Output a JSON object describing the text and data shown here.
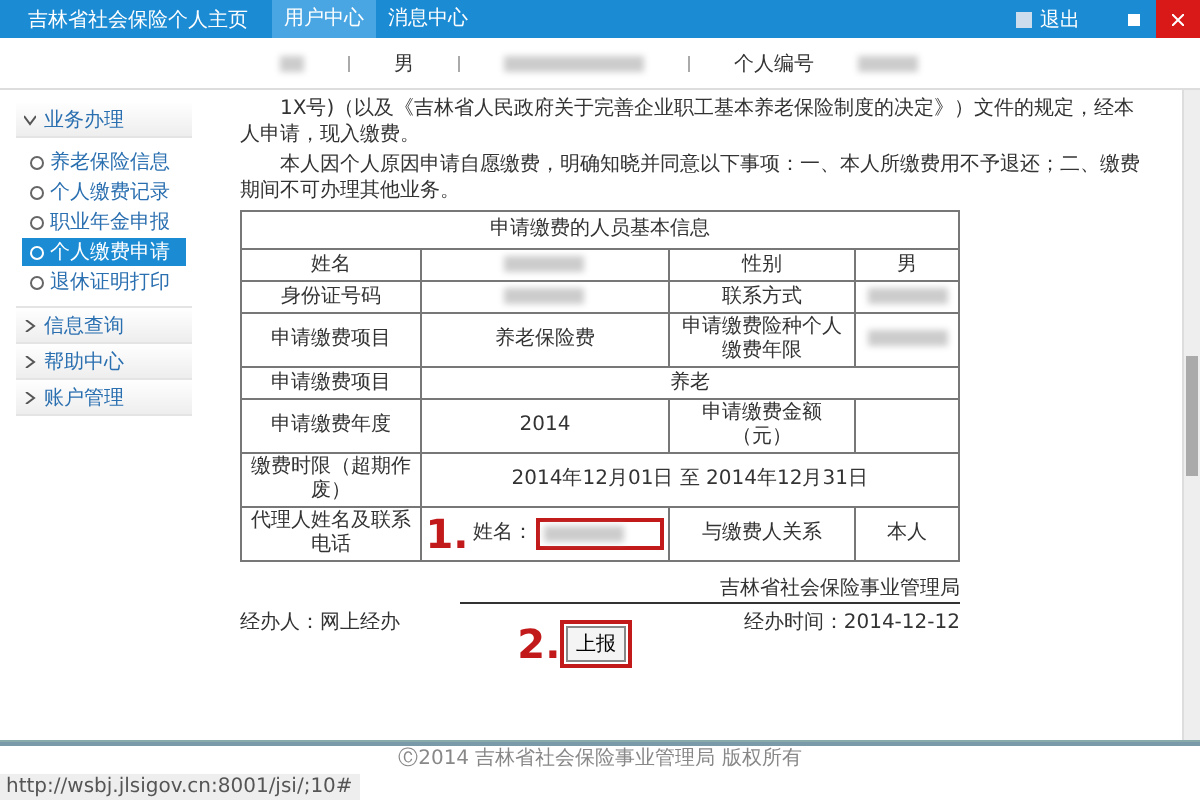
{
  "header": {
    "title": "吉林省社会保险个人主页",
    "tabs": [
      {
        "label": "用户中心",
        "selected": true
      },
      {
        "label": "消息中心",
        "selected": false
      }
    ],
    "logout": "退出"
  },
  "info_bar": {
    "items": [
      "男",
      "个人编号"
    ]
  },
  "sidebar": {
    "groups": [
      {
        "label": "业务办理",
        "expanded": true,
        "items": [
          {
            "label": "养老保险信息",
            "selected": false
          },
          {
            "label": "个人缴费记录",
            "selected": false
          },
          {
            "label": "职业年金申报",
            "selected": false
          },
          {
            "label": "个人缴费申请",
            "selected": true
          },
          {
            "label": "退休证明打印",
            "selected": false
          }
        ]
      },
      {
        "label": "信息查询",
        "expanded": false
      },
      {
        "label": "帮助中心",
        "expanded": false
      },
      {
        "label": "账户管理",
        "expanded": false
      }
    ]
  },
  "document": {
    "paragraphs": [
      "1X号)（以及《吉林省人民政府关于完善企业职工基本养老保险制度的决定》）文件的规定，经本人申请，现入缴费。",
      "本人因个人原因申请自愿缴费，明确知晓并同意以下事项：一、本人所缴费用不予退还；二、缴费期间不可办理其他业务。"
    ],
    "table": {
      "title": "申请缴费的人员基本信息",
      "rows": [
        [
          {
            "kind": "label",
            "text": "姓名"
          },
          {
            "kind": "blurred"
          },
          {
            "kind": "label",
            "text": "性别"
          },
          {
            "kind": "value",
            "text": "男"
          }
        ],
        [
          {
            "kind": "label",
            "text": "身份证号码"
          },
          {
            "kind": "blurred"
          },
          {
            "kind": "label",
            "text": "联系方式"
          },
          {
            "kind": "blurred"
          }
        ],
        [
          {
            "kind": "label",
            "text": "申请缴费项目"
          },
          {
            "kind": "value",
            "text": "养老保险费"
          },
          {
            "kind": "label",
            "text": "申请缴费险种个人缴费年限"
          },
          {
            "kind": "blurred"
          }
        ],
        [
          {
            "kind": "label",
            "text": "申请缴费项目"
          },
          {
            "kind": "value",
            "text": "养老",
            "colspan": 3
          }
        ],
        [
          {
            "kind": "label",
            "text": "申请缴费年度"
          },
          {
            "kind": "value",
            "text": "2014"
          },
          {
            "kind": "label",
            "text": "申请缴费金额（元）"
          },
          {
            "kind": "empty"
          }
        ],
        [
          {
            "kind": "label",
            "text": "缴费时限（超期作废）"
          },
          {
            "kind": "value",
            "text": "2014年12月01日 至 2014年12月31日",
            "colspan": 3
          }
        ],
        [
          {
            "kind": "label",
            "text": "代理人姓名及联系电话"
          },
          {
            "kind": "input",
            "text": "姓名："
          },
          {
            "kind": "label",
            "text": "与缴费人关系"
          },
          {
            "kind": "value",
            "text": "本人"
          }
        ]
      ]
    },
    "agency": "吉林省社会保险事业管理局",
    "handler": "经办人：网上经办",
    "time": "经办时间：2014-12-12",
    "submit": "上报"
  },
  "annotations": [
    "1.",
    "2."
  ],
  "footer": "Ⓒ2014 吉林省社会保险事业管理局 版权所有",
  "status_url": "http://wsbj.jlsigov.cn:8001/jsi/;10#"
}
